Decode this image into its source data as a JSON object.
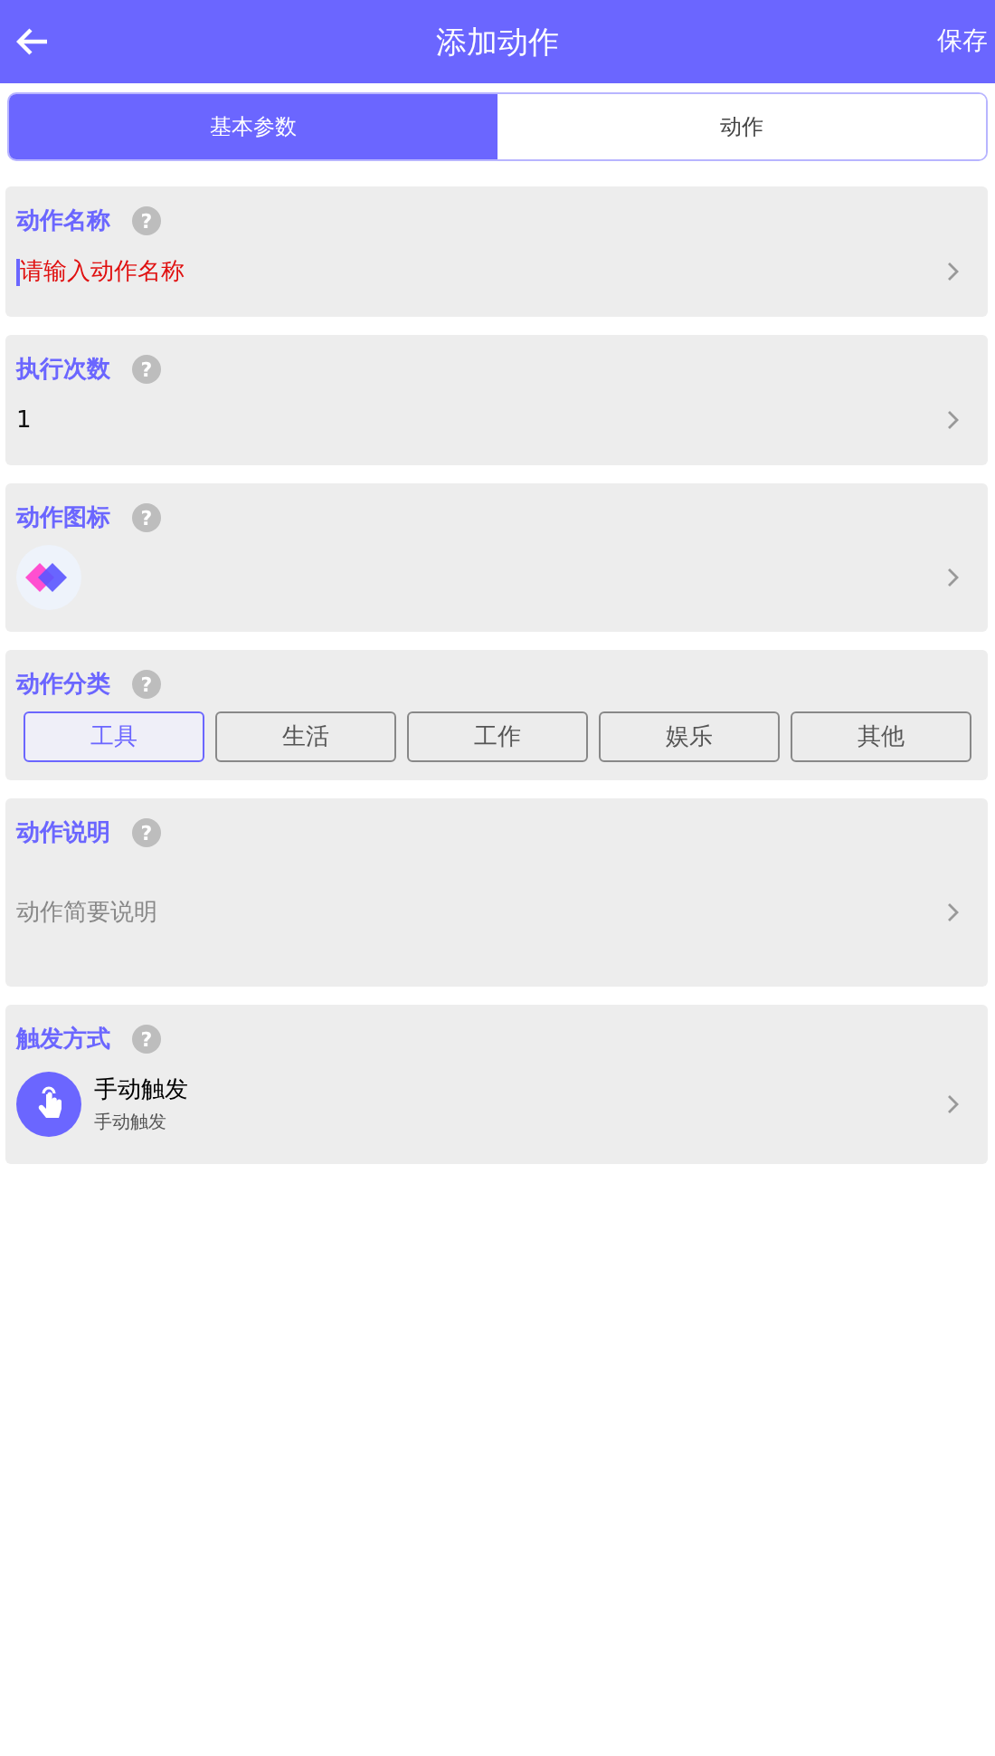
{
  "header": {
    "title": "添加动作",
    "action": "保存"
  },
  "tabs": [
    {
      "label": "基本参数",
      "selected": true
    },
    {
      "label": "动作",
      "selected": false
    }
  ],
  "sections": [
    {
      "kind": "input",
      "label": "动作名称",
      "help": "?",
      "placeholder": "请输入动作名称",
      "focused": true
    },
    {
      "kind": "value",
      "label": "执行次数",
      "help": "?",
      "value": "1"
    },
    {
      "kind": "icon",
      "label": "动作图标",
      "help": "?"
    },
    {
      "kind": "choices",
      "label": "动作分类",
      "help": "?",
      "options": [
        {
          "label": "工具",
          "selected": true
        },
        {
          "label": "生活",
          "selected": false
        },
        {
          "label": "工作",
          "selected": false
        },
        {
          "label": "娱乐",
          "selected": false
        },
        {
          "label": "其他",
          "selected": false
        }
      ]
    },
    {
      "kind": "text",
      "label": "动作说明",
      "help": "?",
      "placeholder": "动作简要说明"
    },
    {
      "kind": "trigger",
      "label": "触发方式",
      "help": "?",
      "title": "手动触发",
      "subtitle": "手动触发"
    }
  ]
}
